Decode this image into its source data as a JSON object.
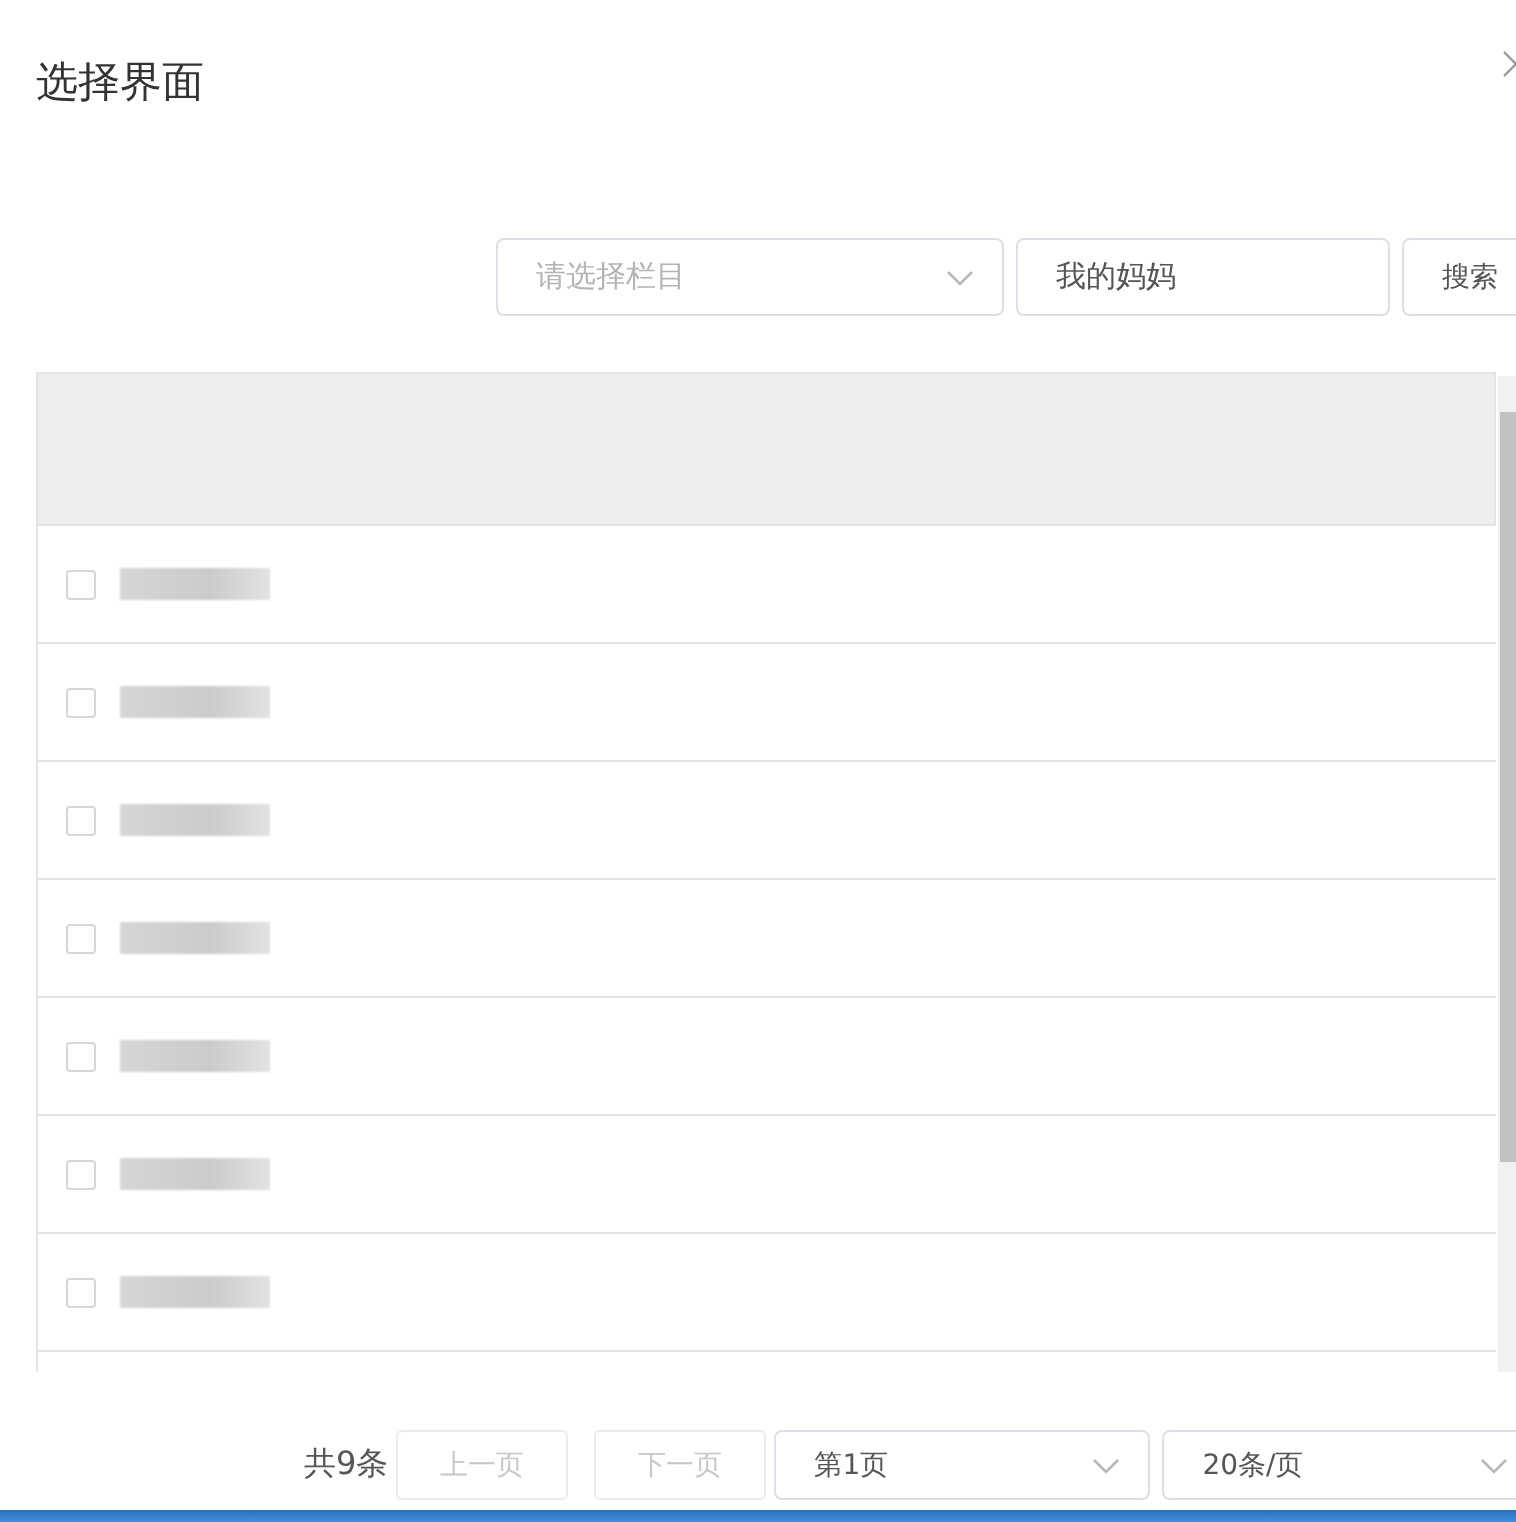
{
  "dialog": {
    "title": "选择界面"
  },
  "filters": {
    "category_select": {
      "placeholder": "请选择栏目"
    },
    "keyword_field": {
      "value": "我的妈妈"
    },
    "search_button": "搜索"
  },
  "table": {
    "rows": [
      {
        "checked": false,
        "kind": "redacted"
      },
      {
        "checked": false,
        "kind": "redacted"
      },
      {
        "checked": false,
        "kind": "redacted"
      },
      {
        "checked": false,
        "kind": "redacted"
      },
      {
        "checked": false,
        "kind": "redacted"
      },
      {
        "checked": false,
        "kind": "redacted"
      },
      {
        "checked": false,
        "kind": "redacted"
      }
    ]
  },
  "pagination": {
    "total": "共9条",
    "prev": {
      "label": "上一页",
      "disabled": true
    },
    "next": {
      "label": "下一页",
      "disabled": true
    },
    "page_select": "第1页",
    "size_select": "20条/页"
  }
}
